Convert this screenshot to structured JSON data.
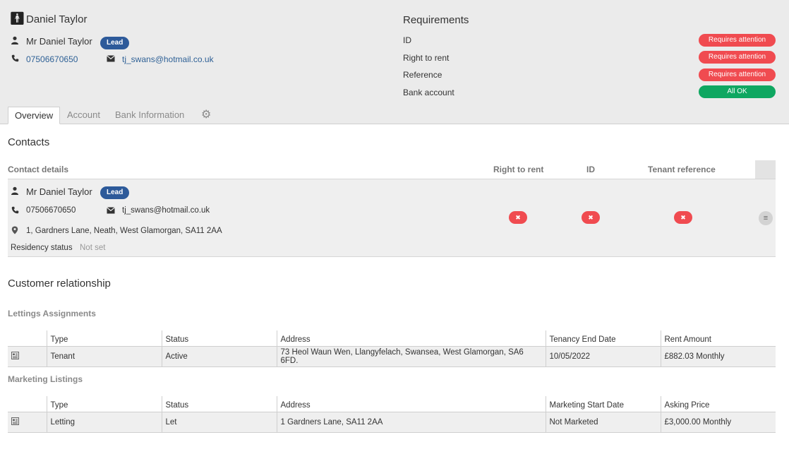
{
  "header": {
    "name": "Daniel Taylor",
    "full_name": "Mr Daniel Taylor",
    "badge": "Lead",
    "phone": "07506670650",
    "email": "tj_swans@hotmail.co.uk"
  },
  "requirements": {
    "title": "Requirements",
    "items": [
      {
        "label": "ID",
        "status": "Requires attention",
        "color": "#f04b50"
      },
      {
        "label": "Right to rent",
        "status": "Requires attention",
        "color": "#f04b50"
      },
      {
        "label": "Reference",
        "status": "Requires attention",
        "color": "#f04b50"
      },
      {
        "label": "Bank account",
        "status": "All OK",
        "color": "#0fa761"
      }
    ]
  },
  "tabs": [
    {
      "label": "Overview",
      "active": true
    },
    {
      "label": "Account",
      "active": false
    },
    {
      "label": "Bank Information",
      "active": false
    }
  ],
  "contacts": {
    "title": "Contacts",
    "columns": {
      "details": "Contact details",
      "right_to_rent": "Right to rent",
      "id": "ID",
      "tenant_reference": "Tenant reference"
    },
    "row": {
      "name": "Mr Daniel Taylor",
      "badge": "Lead",
      "phone": "07506670650",
      "email": "tj_swans@hotmail.co.uk",
      "address": "1, Gardners Lane, Neath, West Glamorgan, SA11 2AA",
      "residency_label": "Residency status",
      "residency_value": "Not set",
      "x_symbol": "✖"
    }
  },
  "customer_relationship": {
    "title": "Customer relationship",
    "lettings": {
      "title": "Lettings Assignments",
      "headers": [
        "Type",
        "Status",
        "Address",
        "Tenancy End Date",
        "Rent Amount"
      ],
      "rows": [
        [
          "Tenant",
          "Active",
          "73 Heol Waun Wen, Llangyfelach, Swansea, West Glamorgan, SA6 6FD.",
          "10/05/2022",
          "£882.03 Monthly"
        ]
      ]
    },
    "marketing": {
      "title": "Marketing Listings",
      "headers": [
        "Type",
        "Status",
        "Address",
        "Marketing Start Date",
        "Asking Price"
      ],
      "rows": [
        [
          "Letting",
          "Let",
          "1 Gardners Lane, SA11 2AA",
          "Not Marketed",
          "£3,000.00 Monthly"
        ]
      ]
    }
  },
  "icons": {
    "person_large": "person-standing-icon",
    "person": "user-icon",
    "phone": "phone-icon",
    "email": "envelope-icon",
    "location": "map-pin-icon",
    "settings": "gear-icon",
    "row_menu": "menu-icon",
    "row_type": "listing-icon"
  }
}
